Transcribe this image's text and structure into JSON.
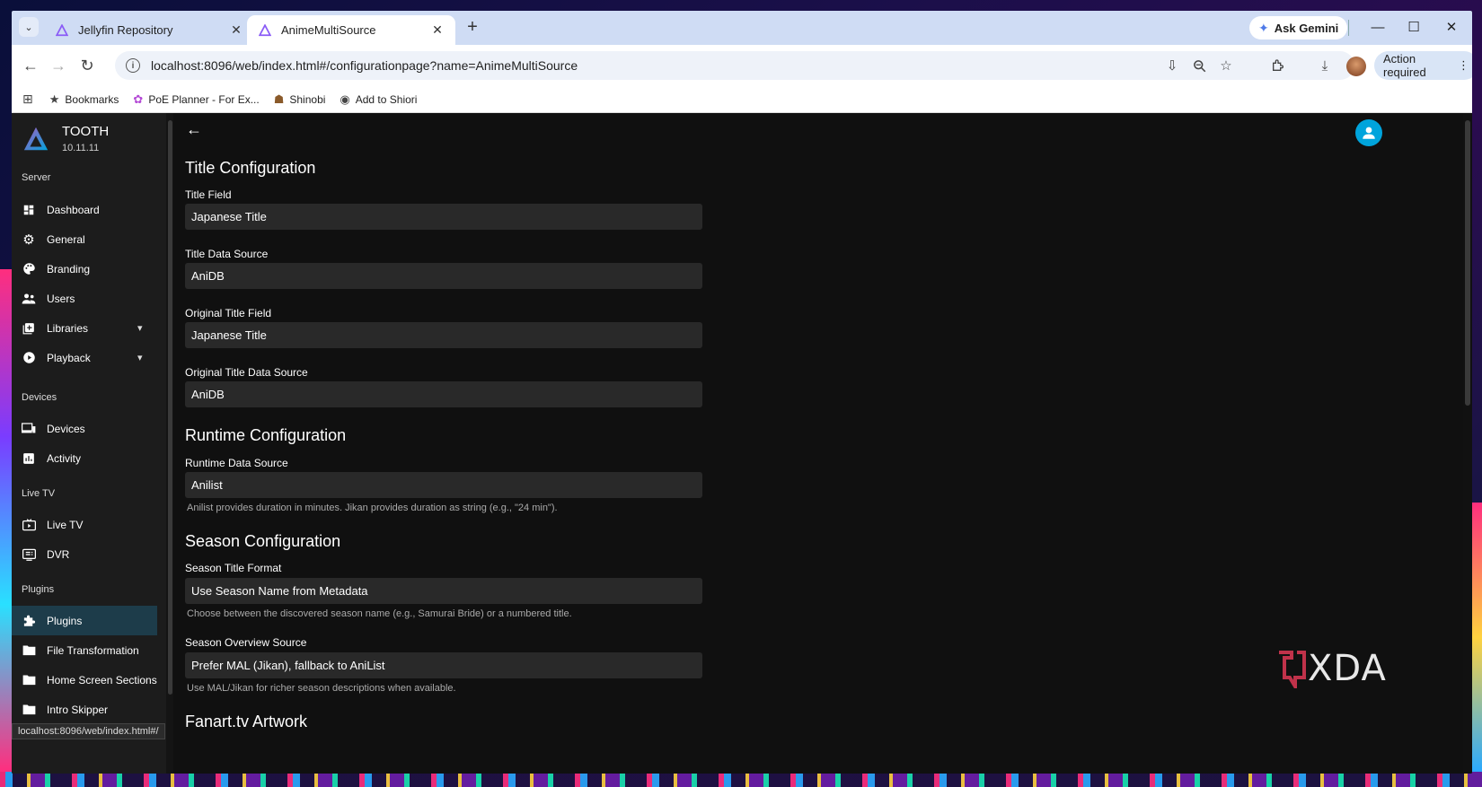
{
  "browser": {
    "tabs": [
      {
        "label": "Jellyfin Repository",
        "active": false
      },
      {
        "label": "AnimeMultiSource",
        "active": true
      }
    ],
    "new_tab_icon": "+",
    "ask_gemini": "Ask Gemini",
    "url": "localhost:8096/web/index.html#/configurationpage?name=AnimeMultiSource",
    "action_required": "Action required",
    "bookmarks": [
      {
        "label": "Bookmarks",
        "icon": "star-icon"
      },
      {
        "label": "PoE Planner - For Ex...",
        "icon": "poe-icon"
      },
      {
        "label": "Shinobi",
        "icon": "shinobi-icon"
      },
      {
        "label": "Add to Shiori",
        "icon": "globe-icon"
      }
    ],
    "status_url": "localhost:8096/web/index.html#/"
  },
  "sidebar": {
    "server_name": "TOOTH",
    "version": "10.11.11",
    "sections": [
      {
        "title": "Server",
        "items": [
          {
            "label": "Dashboard",
            "icon": "dashboard-icon"
          },
          {
            "label": "General",
            "icon": "gear-icon"
          },
          {
            "label": "Branding",
            "icon": "palette-icon"
          },
          {
            "label": "Users",
            "icon": "users-icon"
          },
          {
            "label": "Libraries",
            "icon": "library-add-icon",
            "expandable": true
          },
          {
            "label": "Playback",
            "icon": "play-circle-icon",
            "expandable": true
          }
        ]
      },
      {
        "title": "Devices",
        "items": [
          {
            "label": "Devices",
            "icon": "devices-icon"
          },
          {
            "label": "Activity",
            "icon": "activity-icon"
          }
        ]
      },
      {
        "title": "Live TV",
        "items": [
          {
            "label": "Live TV",
            "icon": "live-tv-icon"
          },
          {
            "label": "DVR",
            "icon": "dvr-icon"
          }
        ]
      },
      {
        "title": "Plugins",
        "items": [
          {
            "label": "Plugins",
            "icon": "puzzle-icon",
            "active": true
          },
          {
            "label": "File Transformation",
            "icon": "folder-icon"
          },
          {
            "label": "Home Screen Sections",
            "icon": "folder-icon"
          },
          {
            "label": "Intro Skipper",
            "icon": "folder-icon"
          }
        ]
      }
    ]
  },
  "main": {
    "title_config": {
      "heading": "Title Configuration",
      "title_field_label": "Title Field",
      "title_field_value": "Japanese Title",
      "title_source_label": "Title Data Source",
      "title_source_value": "AniDB",
      "orig_title_label": "Original Title Field",
      "orig_title_value": "Japanese Title",
      "orig_source_label": "Original Title Data Source",
      "orig_source_value": "AniDB"
    },
    "runtime_config": {
      "heading": "Runtime Configuration",
      "source_label": "Runtime Data Source",
      "source_value": "Anilist",
      "help": "Anilist provides duration in minutes. Jikan provides duration as string (e.g., \"24 min\")."
    },
    "season_config": {
      "heading": "Season Configuration",
      "format_label": "Season Title Format",
      "format_value": "Use Season Name from Metadata",
      "format_help": "Choose between the discovered season name (e.g., Samurai Bride) or a numbered title.",
      "overview_label": "Season Overview Source",
      "overview_value": "Prefer MAL (Jikan), fallback to AniList",
      "overview_help": "Use MAL/Jikan for richer season descriptions when available."
    },
    "fanart_heading": "Fanart.tv Artwork"
  },
  "watermark": "XDA",
  "colors": {
    "accent": "#00a4dc",
    "active_nav": "#1d3c4a",
    "field_bg": "#292929"
  }
}
